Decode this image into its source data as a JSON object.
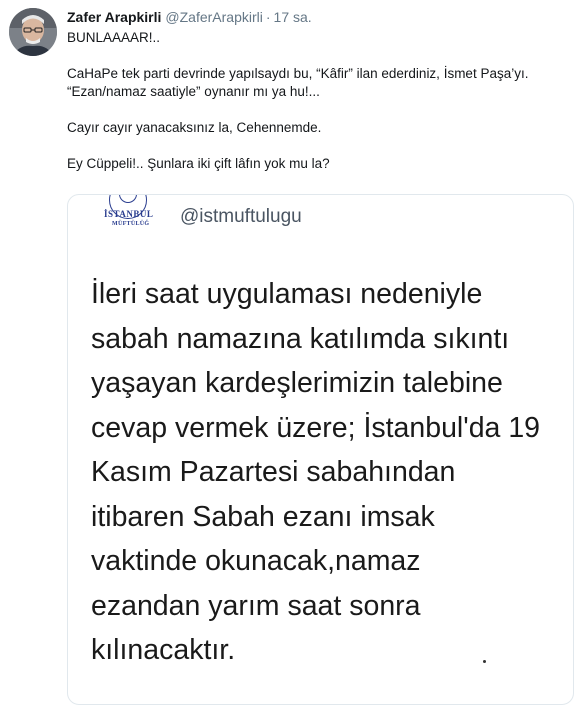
{
  "tweet": {
    "author_name": "Zafer Arapkirli",
    "handle": "@ZaferArapkirli",
    "separator": "·",
    "time": "17 sa.",
    "lines": [
      "BUNLAAAAR!..",
      "CaHaPe tek parti devrinde yapılsaydı bu, “Kâfir” ilan ederdiniz, İsmet Paşa’yı.",
      "“Ezan/namaz saatiyle” oynanır mı ya hu!...",
      "Cayır cayır yanacaksınız la, Cehennemde.",
      "Ey Cüppeli!.. Şunlara iki çift lâfın yok mu la?"
    ]
  },
  "embedded": {
    "handle": "@istmuftulugu",
    "logo_text_1": "İSTANBUL",
    "logo_text_2": "MÜFTÜLÜĞ",
    "text": "İleri saat uygulaması nedeniyle\nsabah namazına katılımda sıkıntı\nyaşayan kardeşlerimizin talebine\ncevap vermek üzere; İstanbul'da 19\nKasım Pazartesi sabahından\nitibaren Sabah ezanı imsak\nvaktinde okunacak,namaz\nezandan yarım saat sonra\nkılınacaktır."
  },
  "colors": {
    "text": "#14171a",
    "secondary": "#657786",
    "border": "#e1e8ed",
    "logo_blue": "#2a3d8f"
  }
}
